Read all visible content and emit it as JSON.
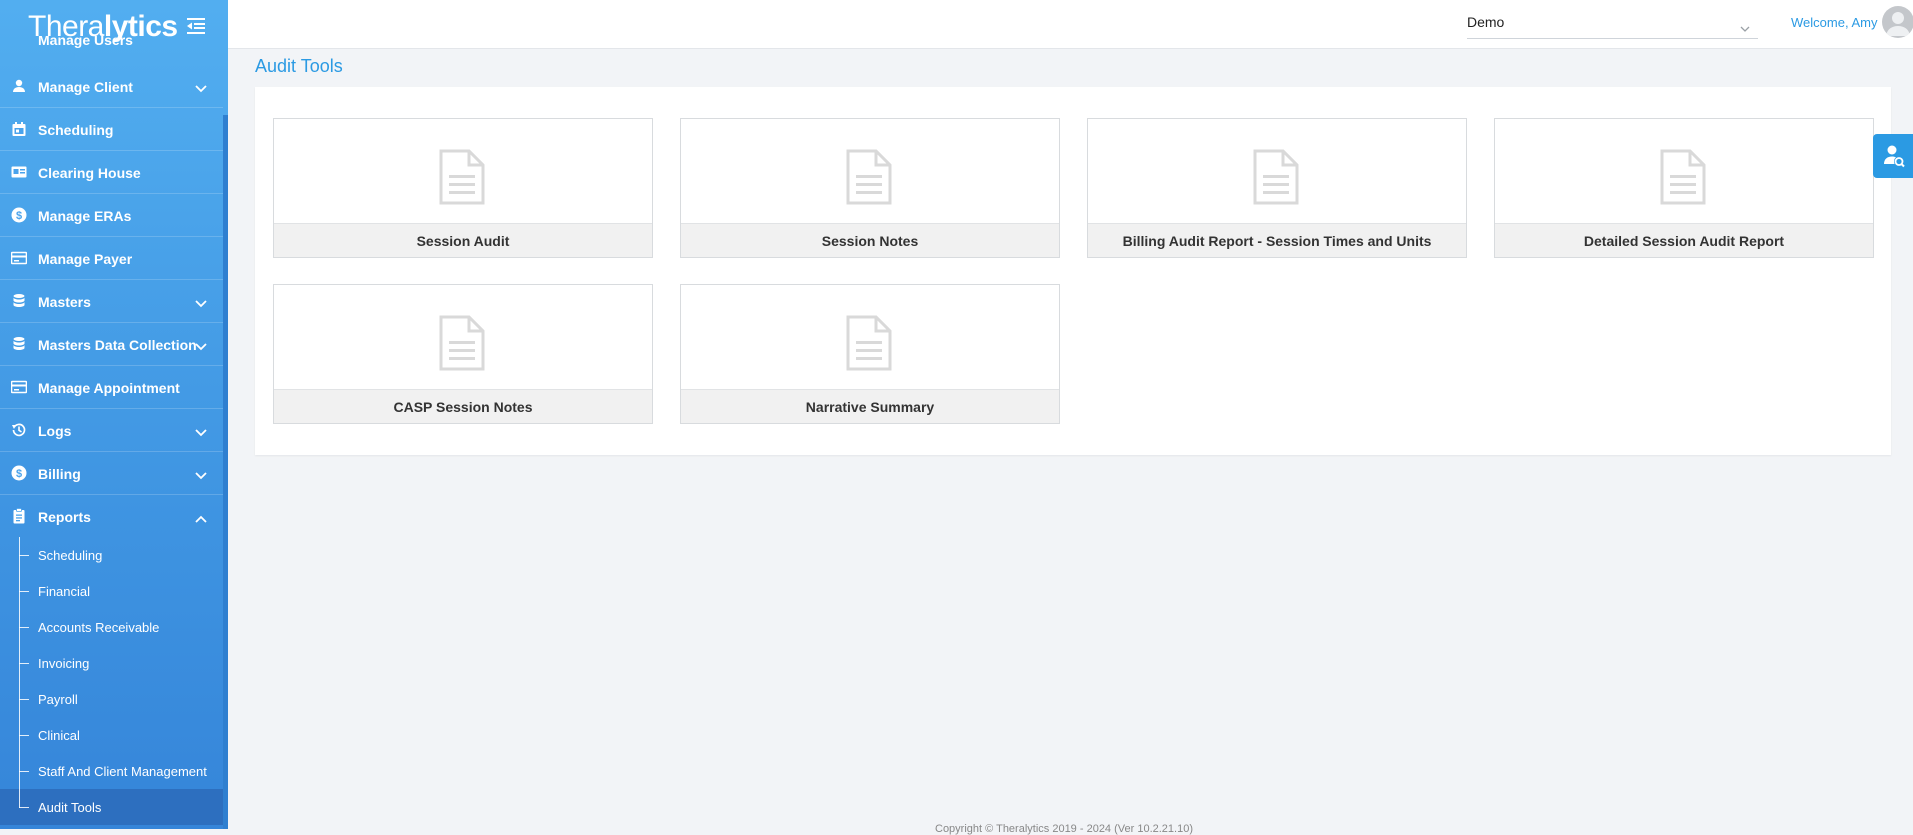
{
  "app": {
    "logo_prefix": "Thera",
    "logo_suffix": "lytics"
  },
  "sidebar": {
    "partial_item": "Manage Users",
    "items": [
      {
        "label": "Manage Client",
        "icon": "person-icon",
        "expandable": true
      },
      {
        "label": "Scheduling",
        "icon": "calendar-icon",
        "expandable": false
      },
      {
        "label": "Clearing House",
        "icon": "id-card-icon",
        "expandable": false
      },
      {
        "label": "Manage ERAs",
        "icon": "dollar-icon",
        "expandable": false
      },
      {
        "label": "Manage Payer",
        "icon": "card-icon",
        "expandable": false
      },
      {
        "label": "Masters",
        "icon": "database-icon",
        "expandable": true
      },
      {
        "label": "Masters Data Collection",
        "icon": "database-icon",
        "expandable": true
      },
      {
        "label": "Manage Appointment",
        "icon": "card-icon",
        "expandable": false
      },
      {
        "label": "Logs",
        "icon": "history-icon",
        "expandable": true
      },
      {
        "label": "Billing",
        "icon": "dollar-icon",
        "expandable": true
      },
      {
        "label": "Reports",
        "icon": "clipboard-icon",
        "expandable": true,
        "expanded": true
      }
    ],
    "reports_sub": [
      {
        "label": "Scheduling"
      },
      {
        "label": "Financial"
      },
      {
        "label": "Accounts Receivable"
      },
      {
        "label": "Invoicing"
      },
      {
        "label": "Payroll"
      },
      {
        "label": "Clinical"
      },
      {
        "label": "Staff And Client Management"
      },
      {
        "label": "Audit Tools",
        "active": true
      }
    ]
  },
  "header": {
    "org_select_value": "Demo",
    "welcome": "Welcome, Amy"
  },
  "main": {
    "title": "Audit Tools",
    "cards": [
      {
        "label": "Session Audit"
      },
      {
        "label": "Session Notes"
      },
      {
        "label": "Billing Audit Report - Session Times and Units"
      },
      {
        "label": "Detailed Session Audit Report"
      },
      {
        "label": "CASP Session Notes"
      },
      {
        "label": "Narrative Summary"
      }
    ]
  },
  "footer": {
    "text": "Copyright © Theralytics 2019 - 2024 (Ver 10.2.21.10)"
  },
  "colors": {
    "accent": "#2b9ae3",
    "sidebar_top": "#52aef0",
    "sidebar_bottom": "#3585d9",
    "active_sub": "#2d6fbf"
  }
}
